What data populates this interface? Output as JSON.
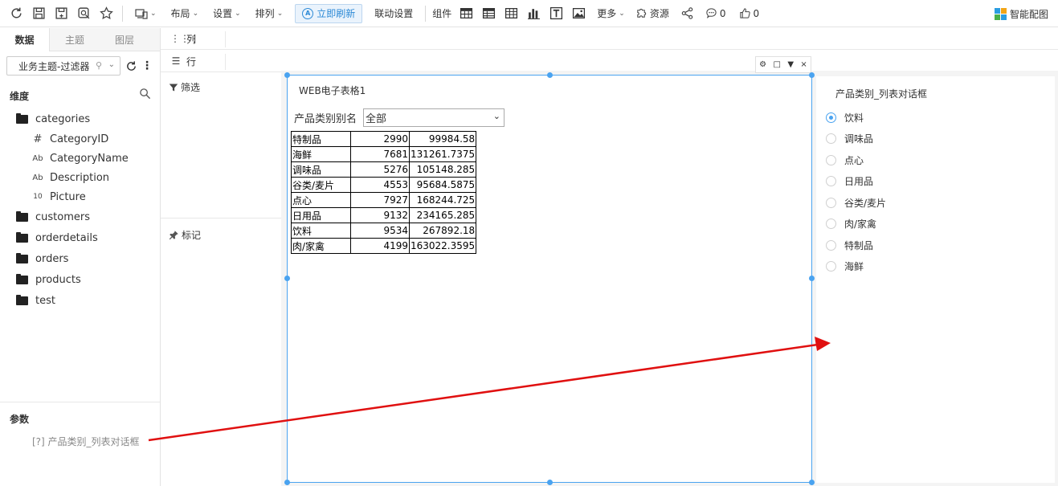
{
  "toolbar": {
    "layout_label": "布局",
    "settings_label": "设置",
    "arrange_label": "排列",
    "refresh_label": "立即刷新",
    "linkage_label": "联动设置",
    "components_label": "组件",
    "more_label": "更多",
    "resources_label": "资源",
    "comment_count": "0",
    "like_count": "0",
    "smart_chart_label": "智能配图"
  },
  "left_panel": {
    "tabs": [
      "数据",
      "主题",
      "图层"
    ],
    "theme_select": "业务主题-过滤器",
    "dimension_header": "维度",
    "tree": [
      {
        "label": "categories",
        "type": "folder-open"
      },
      {
        "label": "CategoryID",
        "type": "number"
      },
      {
        "label": "CategoryName",
        "type": "text"
      },
      {
        "label": "Description",
        "type": "text"
      },
      {
        "label": "Picture",
        "type": "binary"
      },
      {
        "label": "customers",
        "type": "folder"
      },
      {
        "label": "orderdetails",
        "type": "folder"
      },
      {
        "label": "orders",
        "type": "folder"
      },
      {
        "label": "products",
        "type": "folder"
      },
      {
        "label": "test",
        "type": "folder"
      }
    ],
    "type_glyphs": {
      "number": "#",
      "text": "Ab",
      "binary": "10"
    },
    "params_header": "参数",
    "param_item": "[?] 产品类别_列表对话框"
  },
  "shelves": {
    "columns_label": "列",
    "rows_label": "行",
    "filter_label": "筛选",
    "mark_label": "标记"
  },
  "report": {
    "title": "WEB电子表格1",
    "filter_label": "产品类别别名",
    "filter_value": "全部",
    "rows": [
      [
        "特制品",
        "2990",
        "99984.58"
      ],
      [
        "海鲜",
        "7681",
        "131261.7375"
      ],
      [
        "调味品",
        "5276",
        "105148.285"
      ],
      [
        "谷类/麦片",
        "4553",
        "95684.5875"
      ],
      [
        "点心",
        "7927",
        "168244.725"
      ],
      [
        "日用品",
        "9132",
        "234165.285"
      ],
      [
        "饮料",
        "9534",
        "267892.18"
      ],
      [
        "肉/家禽",
        "4199",
        "163022.3595"
      ]
    ]
  },
  "radio_panel": {
    "title": "产品类别_列表对话框",
    "options": [
      "饮料",
      "调味品",
      "点心",
      "日用品",
      "谷类/麦片",
      "肉/家禽",
      "特制品",
      "海鲜"
    ],
    "selected_index": 0
  },
  "colors": {
    "accent": "#4aa3f0",
    "annotation_arrow": "#e01010"
  }
}
